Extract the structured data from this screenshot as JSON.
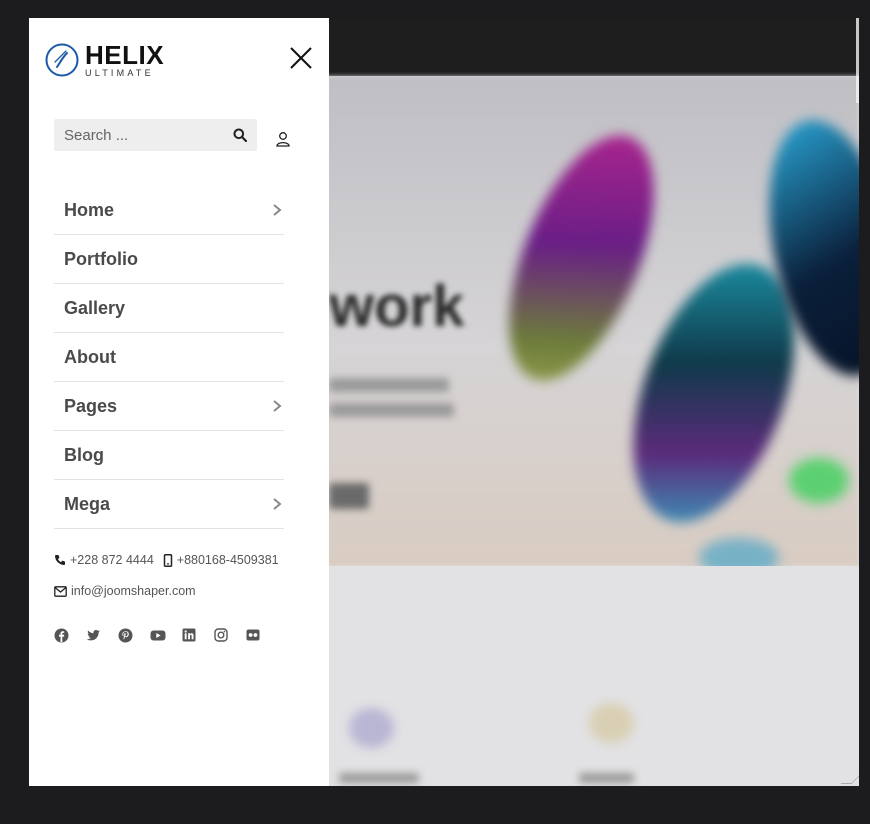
{
  "brand": {
    "name": "HELIX",
    "tagline": "ULTIMATE",
    "accent": "#1b5aa8"
  },
  "search": {
    "placeholder": "Search ..."
  },
  "menu": {
    "items": [
      {
        "label": "Home",
        "has_children": true
      },
      {
        "label": "Portfolio",
        "has_children": false
      },
      {
        "label": "Gallery",
        "has_children": false
      },
      {
        "label": "About",
        "has_children": false
      },
      {
        "label": "Pages",
        "has_children": true
      },
      {
        "label": "Blog",
        "has_children": false
      },
      {
        "label": "Mega",
        "has_children": true
      }
    ]
  },
  "contact": {
    "phone": "+228 872 4444",
    "mobile": "+880168-4509381",
    "email": "info@joomshaper.com"
  },
  "socials": [
    "facebook-icon",
    "twitter-icon",
    "pinterest-icon",
    "youtube-icon",
    "linkedin-icon",
    "instagram-icon",
    "flickr-icon"
  ],
  "colors": {
    "panel_bg": "#ffffff",
    "menu_text": "#4a4a4a",
    "backdrop": "#1c1c1e"
  },
  "background_page": {
    "heading_fragment": "work"
  }
}
